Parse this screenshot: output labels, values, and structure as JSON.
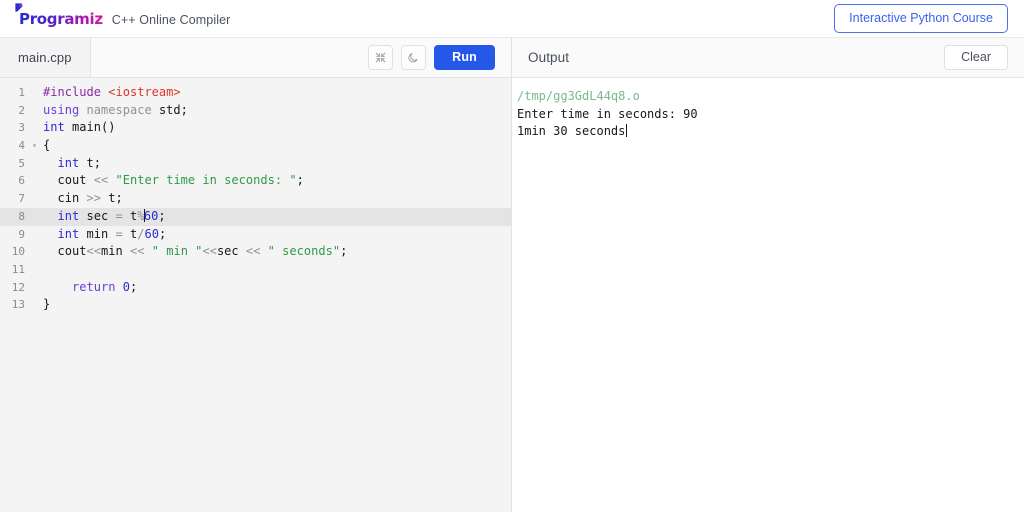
{
  "header": {
    "logo_text": "Programiz",
    "logo_icon": "programiz-arrow-icon",
    "subtitle": "C++ Online Compiler",
    "cta_label": "Interactive Python Course",
    "cta_color": "#3a63ef"
  },
  "editor_panel": {
    "tab_label": "main.cpp",
    "collapse_icon": "collapse-arrows-icon",
    "theme_icon": "moon-icon",
    "run_label": "Run",
    "run_color": "#2557e8",
    "active_line": 8,
    "cursor": {
      "line": 8,
      "column": 15
    },
    "lines": [
      {
        "num": "1",
        "fold": "",
        "tokens": [
          {
            "t": "#include",
            "c": "t-pre"
          },
          {
            "t": " ",
            "c": "t-plain"
          },
          {
            "t": "<iostream>",
            "c": "t-inc"
          }
        ]
      },
      {
        "num": "2",
        "fold": "",
        "tokens": [
          {
            "t": "using",
            "c": "t-kw2"
          },
          {
            "t": " ",
            "c": "t-plain"
          },
          {
            "t": "namespace",
            "c": "t-ns"
          },
          {
            "t": " ",
            "c": "t-plain"
          },
          {
            "t": "std",
            "c": "t-plain"
          },
          {
            "t": ";",
            "c": "t-plain"
          }
        ]
      },
      {
        "num": "3",
        "fold": "",
        "tokens": [
          {
            "t": "int",
            "c": "t-kw"
          },
          {
            "t": " ",
            "c": "t-plain"
          },
          {
            "t": "main",
            "c": "t-fn"
          },
          {
            "t": "()",
            "c": "t-plain"
          }
        ]
      },
      {
        "num": "4",
        "fold": "▾",
        "tokens": [
          {
            "t": "{",
            "c": "t-plain"
          }
        ]
      },
      {
        "num": "5",
        "fold": "",
        "tokens": [
          {
            "t": "  ",
            "c": "t-plain"
          },
          {
            "t": "int",
            "c": "t-kw"
          },
          {
            "t": " ",
            "c": "t-plain"
          },
          {
            "t": "t;",
            "c": "t-plain"
          }
        ]
      },
      {
        "num": "6",
        "fold": "",
        "tokens": [
          {
            "t": "  ",
            "c": "t-plain"
          },
          {
            "t": "cout",
            "c": "t-plain"
          },
          {
            "t": " ",
            "c": "t-plain"
          },
          {
            "t": "<<",
            "c": "t-op"
          },
          {
            "t": " ",
            "c": "t-plain"
          },
          {
            "t": "\"Enter time in seconds: \"",
            "c": "t-str"
          },
          {
            "t": ";",
            "c": "t-plain"
          }
        ]
      },
      {
        "num": "7",
        "fold": "",
        "tokens": [
          {
            "t": "  ",
            "c": "t-plain"
          },
          {
            "t": "cin",
            "c": "t-plain"
          },
          {
            "t": " ",
            "c": "t-plain"
          },
          {
            "t": ">>",
            "c": "t-op"
          },
          {
            "t": " ",
            "c": "t-plain"
          },
          {
            "t": "t;",
            "c": "t-plain"
          }
        ]
      },
      {
        "num": "8",
        "fold": "",
        "active": true,
        "tokens": [
          {
            "t": "  ",
            "c": "t-plain"
          },
          {
            "t": "int",
            "c": "t-kw"
          },
          {
            "t": " ",
            "c": "t-plain"
          },
          {
            "t": "sec",
            "c": "t-plain"
          },
          {
            "t": " ",
            "c": "t-plain"
          },
          {
            "t": "=",
            "c": "t-op"
          },
          {
            "t": " ",
            "c": "t-plain"
          },
          {
            "t": "t",
            "c": "t-plain"
          },
          {
            "t": "%",
            "c": "t-op"
          },
          {
            "t": "CARET",
            "c": "caret-token"
          },
          {
            "t": "60",
            "c": "t-num"
          },
          {
            "t": ";",
            "c": "t-plain"
          }
        ]
      },
      {
        "num": "9",
        "fold": "",
        "tokens": [
          {
            "t": "  ",
            "c": "t-plain"
          },
          {
            "t": "int",
            "c": "t-kw"
          },
          {
            "t": " ",
            "c": "t-plain"
          },
          {
            "t": "min",
            "c": "t-plain"
          },
          {
            "t": " ",
            "c": "t-plain"
          },
          {
            "t": "=",
            "c": "t-op"
          },
          {
            "t": " ",
            "c": "t-plain"
          },
          {
            "t": "t",
            "c": "t-plain"
          },
          {
            "t": "/",
            "c": "t-op"
          },
          {
            "t": "60",
            "c": "t-num"
          },
          {
            "t": ";",
            "c": "t-plain"
          }
        ]
      },
      {
        "num": "10",
        "fold": "",
        "tokens": [
          {
            "t": "  ",
            "c": "t-plain"
          },
          {
            "t": "cout",
            "c": "t-plain"
          },
          {
            "t": "<<",
            "c": "t-op"
          },
          {
            "t": "min",
            "c": "t-plain"
          },
          {
            "t": " ",
            "c": "t-plain"
          },
          {
            "t": "<<",
            "c": "t-op"
          },
          {
            "t": " ",
            "c": "t-plain"
          },
          {
            "t": "\" min \"",
            "c": "t-str"
          },
          {
            "t": "<<",
            "c": "t-op"
          },
          {
            "t": "sec",
            "c": "t-plain"
          },
          {
            "t": " ",
            "c": "t-plain"
          },
          {
            "t": "<<",
            "c": "t-op"
          },
          {
            "t": " ",
            "c": "t-plain"
          },
          {
            "t": "\" seconds\"",
            "c": "t-str"
          },
          {
            "t": ";",
            "c": "t-plain"
          }
        ]
      },
      {
        "num": "11",
        "fold": "",
        "tokens": []
      },
      {
        "num": "12",
        "fold": "",
        "tokens": [
          {
            "t": "    ",
            "c": "t-plain"
          },
          {
            "t": "return",
            "c": "t-kw2"
          },
          {
            "t": " ",
            "c": "t-plain"
          },
          {
            "t": "0",
            "c": "t-num"
          },
          {
            "t": ";",
            "c": "t-plain"
          }
        ]
      },
      {
        "num": "13",
        "fold": "",
        "tokens": [
          {
            "t": "}",
            "c": "t-plain"
          }
        ]
      }
    ]
  },
  "output_panel": {
    "title": "Output",
    "clear_label": "Clear",
    "lines": [
      {
        "text": "/tmp/gg3GdL44q8.o",
        "style": "out-path"
      },
      {
        "text": "Enter time in seconds: 90",
        "style": "out-text"
      },
      {
        "text": "1min 30 seconds",
        "style": "out-text",
        "caret": true
      }
    ]
  }
}
